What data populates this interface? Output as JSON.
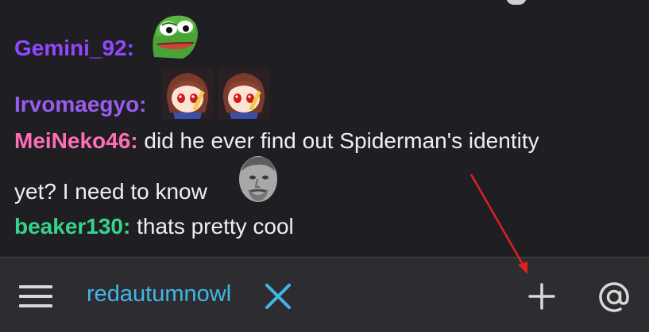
{
  "chat": {
    "messages": [
      {
        "username": "Gemini_92:",
        "username_color": "#9147ff",
        "text": "",
        "emotes": [
          "pepe-frog-emote"
        ]
      },
      {
        "username": "Irvomaegyo:",
        "username_color": "#9a5cf0",
        "text": "",
        "emotes": [
          "anime-girl-emote",
          "anime-girl-emote"
        ]
      },
      {
        "username": "MeiNeko46:",
        "username_color": "#ff6eb4",
        "text": "did he ever find out Spiderman's identity",
        "text_cont": "yet? I need to know",
        "emotes": [
          "kappa-face-emote"
        ]
      },
      {
        "username": "beaker130:",
        "username_color": "#36d48c",
        "text": "thats pretty cool",
        "emotes": []
      }
    ]
  },
  "bottom_bar": {
    "menu_icon": "hamburger-menu-icon",
    "tab_label": "redautumnowl",
    "tab_close_icon": "close-x-icon",
    "add_icon": "plus-icon",
    "mention_icon": "at-sign-icon"
  },
  "colors": {
    "background": "#1f1f23",
    "bar_background": "#2d2d31",
    "accent": "#41b6e6",
    "annotation_arrow": "#e02020"
  }
}
